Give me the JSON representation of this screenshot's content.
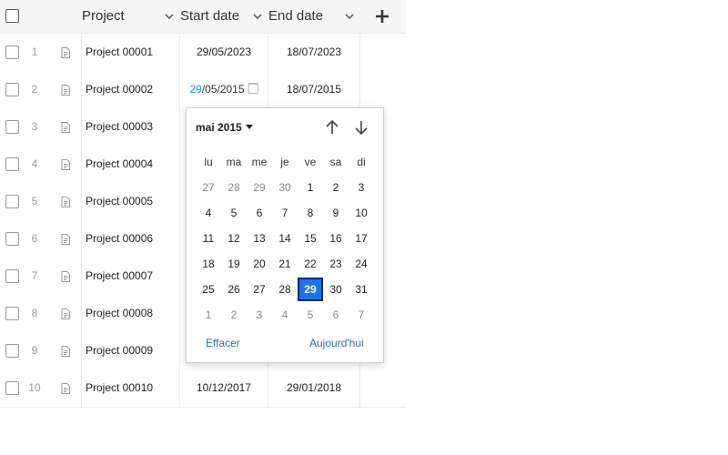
{
  "header": {
    "project_label": "Project",
    "start_label": "Start date",
    "end_label": "End date",
    "add_icon": "plus-icon"
  },
  "rows": [
    {
      "num": "1",
      "name": "Project 00001",
      "start": "29/05/2023",
      "end": "18/07/2023"
    },
    {
      "num": "2",
      "name": "Project 00002",
      "start_day": "29",
      "start_rest": "/05/2015",
      "end": "18/07/2015"
    },
    {
      "num": "3",
      "name": "Project 00003",
      "start": "",
      "end": ""
    },
    {
      "num": "4",
      "name": "Project 00004",
      "start": "",
      "end": ""
    },
    {
      "num": "5",
      "name": "Project 00005",
      "start": "",
      "end": ""
    },
    {
      "num": "6",
      "name": "Project 00006",
      "start": "",
      "end": ""
    },
    {
      "num": "7",
      "name": "Project 00007",
      "start": "",
      "end": ""
    },
    {
      "num": "8",
      "name": "Project 00008",
      "start": "",
      "end": ""
    },
    {
      "num": "9",
      "name": "Project 00009",
      "start": "",
      "end": ""
    },
    {
      "num": "10",
      "name": "Project 00010",
      "start": "10/12/2017",
      "end": "29/01/2018"
    }
  ],
  "picker": {
    "month_label": "mai 2015",
    "weekdays": [
      "lu",
      "ma",
      "me",
      "je",
      "ve",
      "sa",
      "di"
    ],
    "weeks": [
      [
        "27",
        "28",
        "29",
        "30",
        "1",
        "2",
        "3"
      ],
      [
        "4",
        "5",
        "6",
        "7",
        "8",
        "9",
        "10"
      ],
      [
        "11",
        "12",
        "13",
        "14",
        "15",
        "16",
        "17"
      ],
      [
        "18",
        "19",
        "20",
        "21",
        "22",
        "23",
        "24"
      ],
      [
        "25",
        "26",
        "27",
        "28",
        "29",
        "30",
        "31"
      ],
      [
        "1",
        "2",
        "3",
        "4",
        "5",
        "6",
        "7"
      ]
    ],
    "selected_day": "29",
    "clear_label": "Effacer",
    "today_label": "Aujourd'hui",
    "accent_color": "#1a73e8"
  }
}
